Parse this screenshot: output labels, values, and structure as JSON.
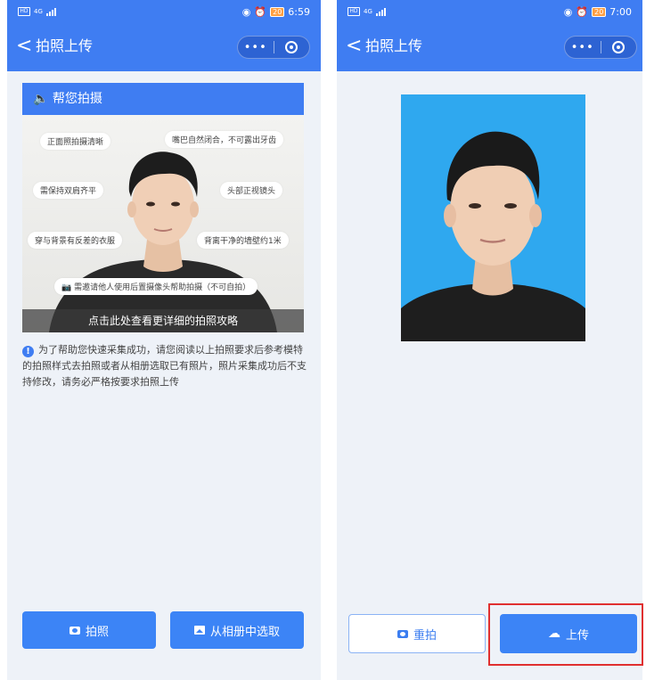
{
  "left_screen": {
    "status": {
      "network": "4G",
      "battery": "20",
      "time": "6:59"
    },
    "nav": {
      "back": "<",
      "title": "拍照上传",
      "more": "•••"
    },
    "guide": {
      "header": "帮您拍摄",
      "tips": [
        "正面照拍摄清晰",
        "嘴巴自然闭合，不可露出牙齿",
        "需保持双肩齐平",
        "头部正视镜头",
        "穿与背景有反差的衣服",
        "背离干净的墙壁约1米",
        "需邀请他人使用后置摄像头帮助拍摄（不可自拍）"
      ],
      "link": "点击此处查看更详细的拍照攻略"
    },
    "notice": "为了帮助您快速采集成功，请您阅读以上拍照要求后参考模特的拍照样式去拍照或者从相册选取已有照片，照片采集成功后不支持修改，请务必严格按要求拍照上传",
    "buttons": {
      "take_photo": "拍照",
      "from_album": "从相册中选取"
    }
  },
  "right_screen": {
    "status": {
      "network": "4G",
      "battery": "20",
      "time": "7:00"
    },
    "nav": {
      "back": "<",
      "title": "拍照上传",
      "more": "•••"
    },
    "buttons": {
      "retake": "重拍",
      "upload": "上传"
    }
  },
  "colors": {
    "primary": "#3f7df2",
    "button": "#3c84f6",
    "photo_bg": "#2fa8ef",
    "highlight": "#e03030",
    "page_bg": "#eef2f8"
  },
  "icons": [
    "speaker-icon",
    "camera-icon",
    "album-icon",
    "upload-cloud-icon",
    "info-icon",
    "record-icon",
    "back-icon"
  ]
}
